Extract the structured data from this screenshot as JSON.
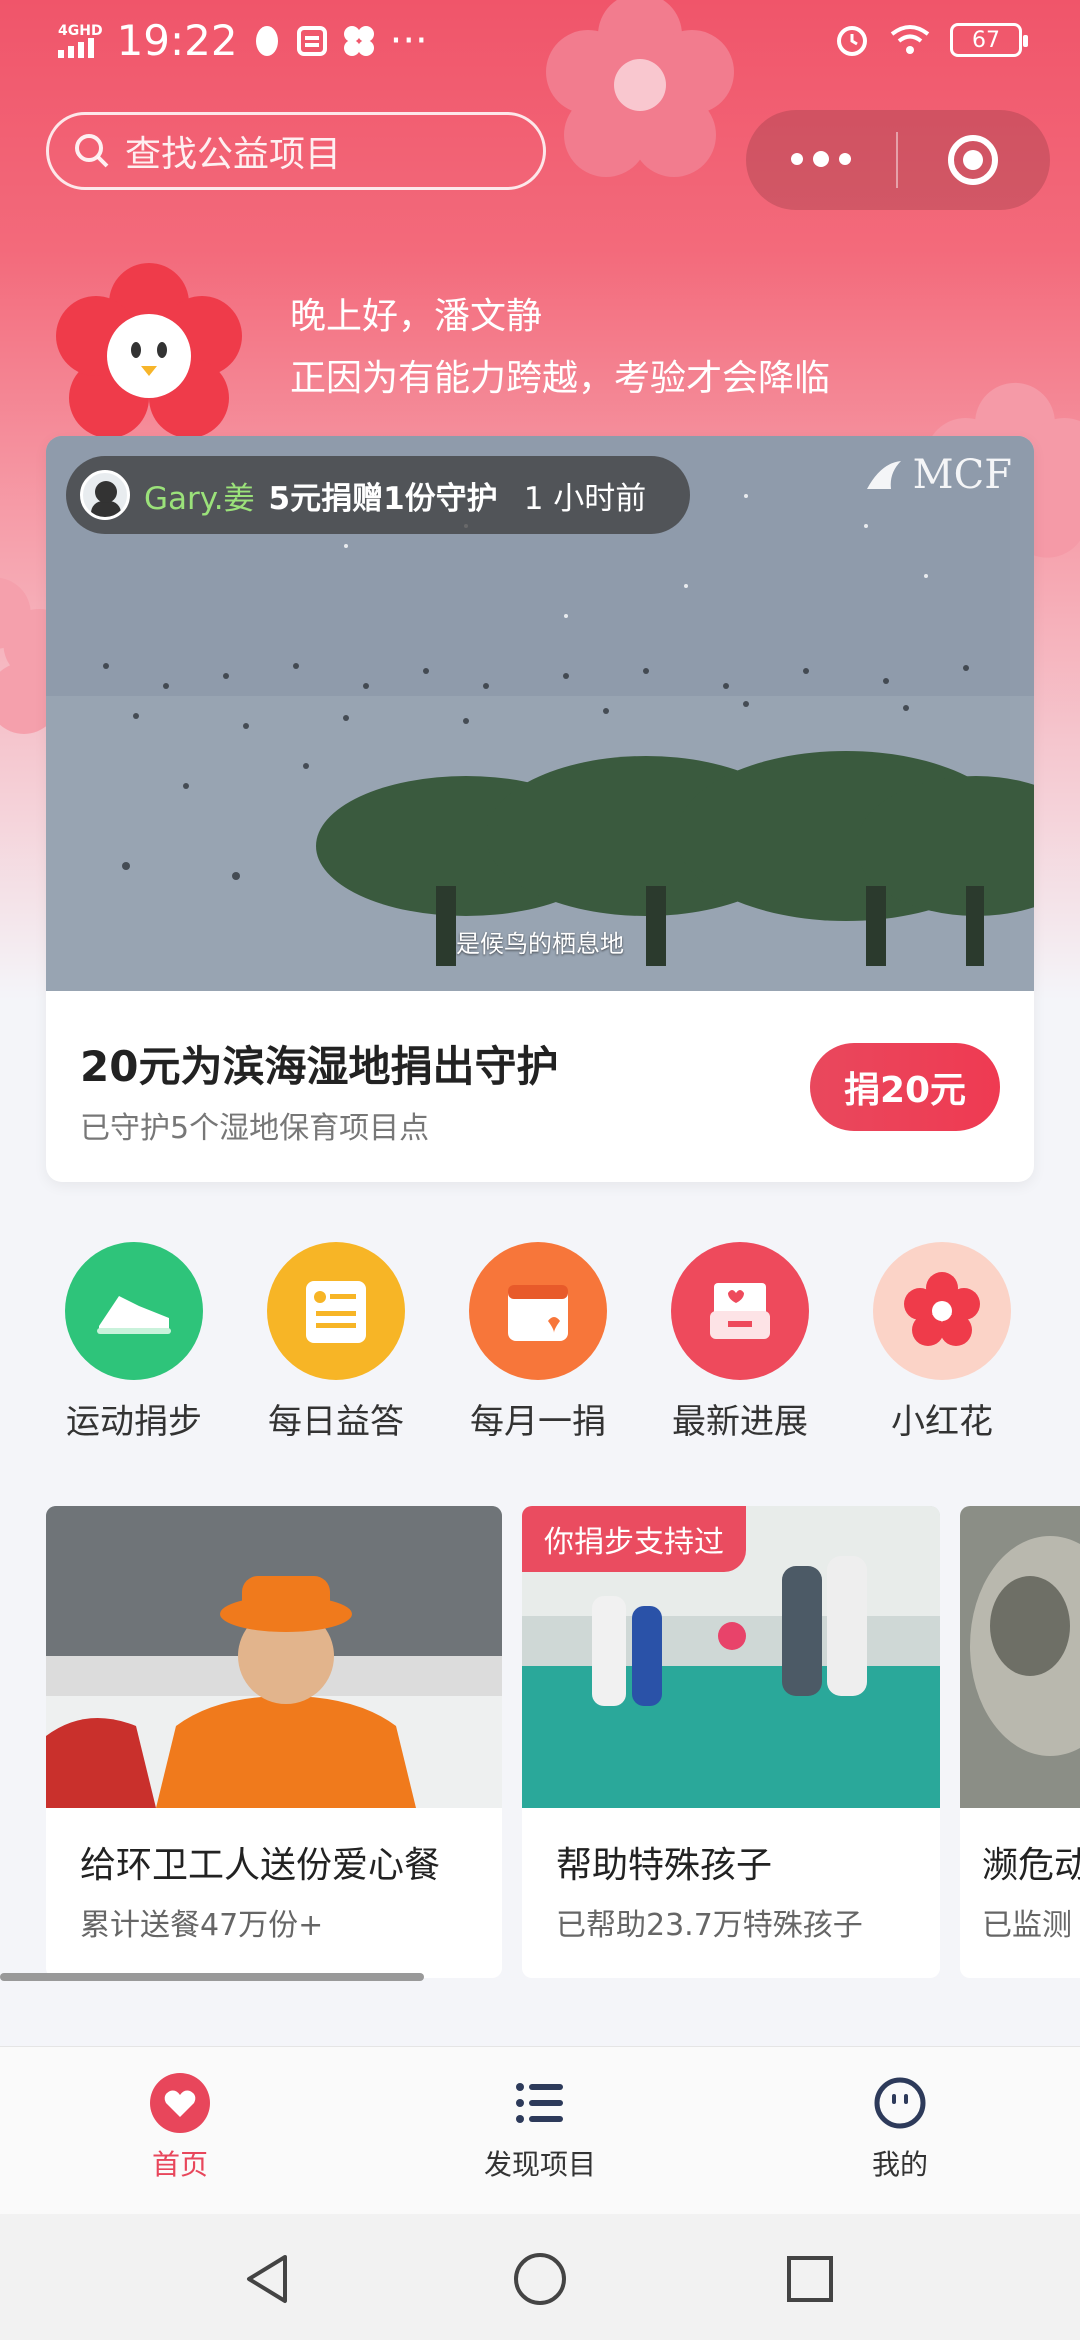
{
  "status_bar": {
    "network": "4GHD",
    "time": "19:22",
    "more": "···",
    "battery": "67"
  },
  "search": {
    "placeholder": "查找公益项目"
  },
  "greeting": {
    "line1": "晚上好，潘文静",
    "line2": "正因为有能力跨越，考验才会降临"
  },
  "featured": {
    "donor_name": "Gary.姜",
    "donor_action": "5元捐赠1份守护",
    "donor_time": "1 小时前",
    "logo_text": "MCF",
    "video_caption": "是候鸟的栖息地",
    "title": "20元为滨海湿地捐出守护",
    "subtitle": "已守护5个湿地保育项目点",
    "button_label": "捐20元"
  },
  "shortcuts": [
    {
      "label": "运动捐步",
      "icon": "sneaker-icon",
      "color": "#2ec47a"
    },
    {
      "label": "每日益答",
      "icon": "quiz-card-icon",
      "color": "#f7b526"
    },
    {
      "label": "每月一捐",
      "icon": "calendar-heart-icon",
      "color": "#f7763a"
    },
    {
      "label": "最新进展",
      "icon": "inbox-heart-icon",
      "color": "#ee4a5c"
    },
    {
      "label": "小红花",
      "icon": "red-flower-icon",
      "color": "#f7b7a6"
    }
  ],
  "projects": [
    {
      "title": "给环卫工人送份爱心餐",
      "subtitle": "累计送餐47万份+",
      "badge": ""
    },
    {
      "title": "帮助特殊孩子",
      "subtitle": "已帮助23.7万特殊孩子",
      "badge": "你捐步支持过"
    },
    {
      "title": "濒危动",
      "subtitle": "已监测",
      "badge": ""
    }
  ],
  "tabbar": {
    "home": "首页",
    "discover": "发现项目",
    "mine": "我的"
  },
  "colors": {
    "brand_red": "#e8465b",
    "hero_top": "#f0556a"
  }
}
